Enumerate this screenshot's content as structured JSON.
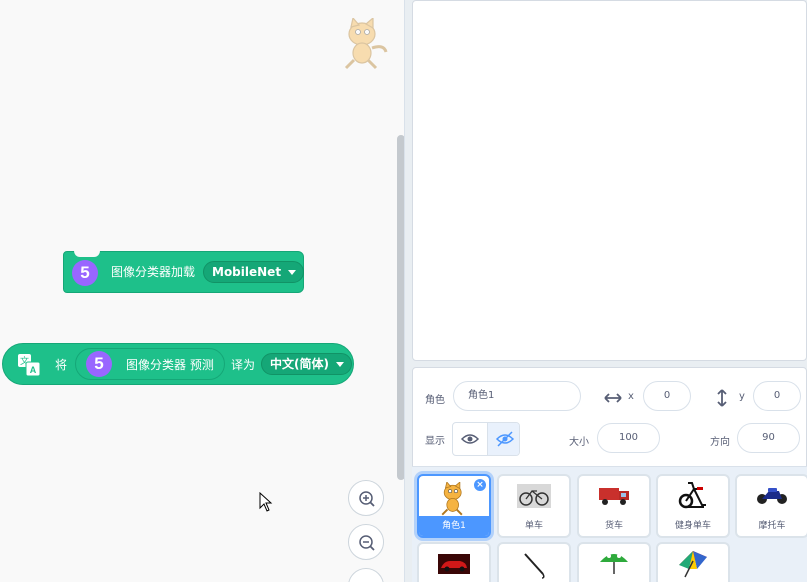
{
  "code_area": {
    "load_block": {
      "num": "5",
      "label": "图像分类器加载",
      "model": "MobileNet"
    },
    "translate_block": {
      "prefix": "将",
      "num": "5",
      "reporter_label": "图像分类器 预测",
      "middle": "译为",
      "language": "中文(简体)"
    }
  },
  "sprite_info": {
    "sprite_label": "角色",
    "sprite_name": "角色1",
    "x_label": "x",
    "x_value": "0",
    "y_label": "y",
    "y_value": "0",
    "show_label": "显示",
    "size_label": "大小",
    "size_value": "100",
    "direction_label": "方向",
    "direction_value": "90"
  },
  "sprites": [
    {
      "name": "角色1",
      "icon": "cat-icon",
      "selected": true
    },
    {
      "name": "单车",
      "icon": "bicycle-icon"
    },
    {
      "name": "货车",
      "icon": "truck-icon"
    },
    {
      "name": "健身单车",
      "icon": "exercise-bike-icon"
    },
    {
      "name": "摩托车",
      "icon": "motorcycle-icon"
    },
    {
      "name": "",
      "icon": "car-icon"
    },
    {
      "name": "",
      "icon": "closed-umbrella-icon"
    },
    {
      "name": "",
      "icon": "green-umbrella-icon"
    },
    {
      "name": "",
      "icon": "rainbow-umbrella-icon"
    }
  ],
  "colors": {
    "extension_green": "#1ec08a",
    "reporter_purple": "#9966ff",
    "accent_blue": "#4c97ff"
  }
}
